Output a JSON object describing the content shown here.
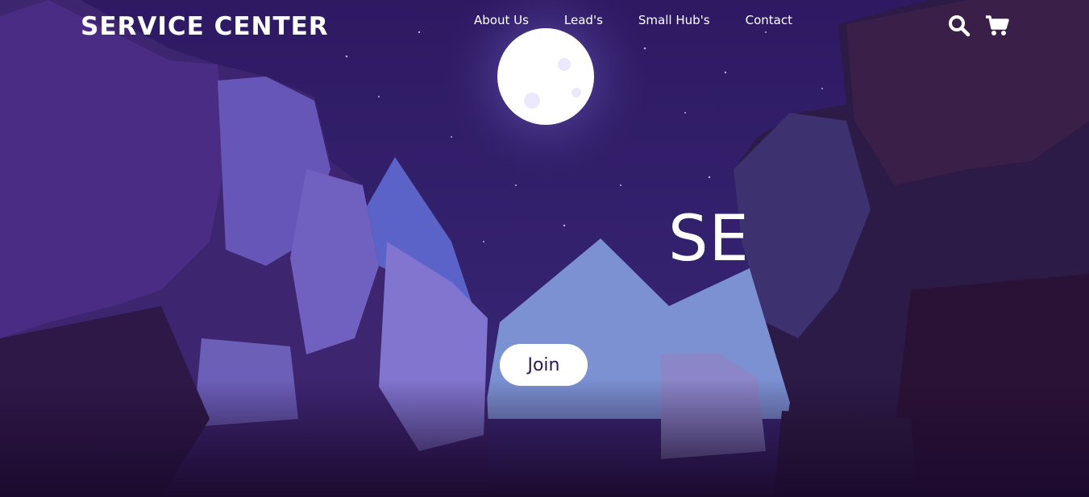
{
  "brand": {
    "name": "SERVICE CENTER"
  },
  "nav": {
    "items": [
      {
        "label": "About Us"
      },
      {
        "label": "Lead's"
      },
      {
        "label": "Small Hub's"
      },
      {
        "label": "Contact"
      }
    ]
  },
  "header_icons": [
    "search-icon",
    "cart-icon"
  ],
  "hero": {
    "headline": "SE",
    "cta_label": "Join"
  },
  "colors": {
    "sky": "#2e1a63",
    "moon": "#ffffff",
    "cliff_dark": "#2b1442",
    "cliff_light": "#6f62c6",
    "ground": "#1c0a2e",
    "button_text": "#2a1650"
  }
}
